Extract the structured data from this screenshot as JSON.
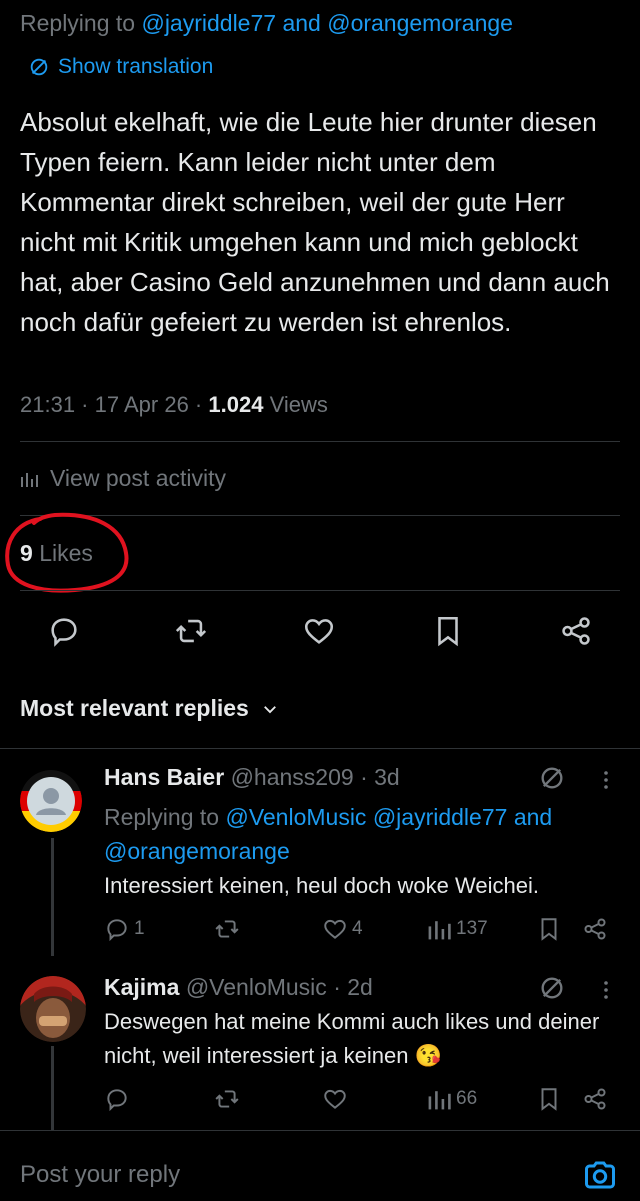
{
  "post": {
    "replying_prefix": "Replying to",
    "replying_handle_1": "@jayriddle77",
    "replying_and": "and",
    "replying_handle_2": "@orangemorange",
    "show_translation": "Show translation",
    "text": "Absolut ekelhaft, wie die Leute hier drunter diesen Typen feiern. Kann leider nicht unter dem Kommentar direkt schreiben, weil der gute Herr nicht mit Kritik umgehen kann und mich geblockt hat, aber Casino Geld anzunehmen und dann auch noch dafür gefeiert zu werden ist ehrenlos.",
    "time": "21:31",
    "date": "17 Apr 26",
    "views_count": "1.024",
    "views_label": "Views",
    "view_activity": "View post activity",
    "likes_count": "9",
    "likes_label": "Likes"
  },
  "action_icons": [
    "reply-icon",
    "repost-icon",
    "like-icon",
    "bookmark-icon",
    "share-icon"
  ],
  "sort": {
    "label": "Most relevant replies"
  },
  "replies": [
    {
      "name": "Hans Baier",
      "handle": "@hanss209",
      "time": "3d",
      "replying_prefix": "Replying to",
      "replying_handles": "@VenloMusic @jayriddle77",
      "replying_and": "and",
      "replying_handle_last": "@orangemorange",
      "text": "Interessiert keinen, heul doch woke Weichei.",
      "reply_count": "1",
      "repost_count": "",
      "like_count": "4",
      "views": "137"
    },
    {
      "name": "Kajima",
      "handle": "@VenloMusic",
      "time": "2d",
      "text": "Deswegen hat meine Kommi auch likes und deiner nicht, weil interessiert ja keinen 😘",
      "reply_count": "",
      "repost_count": "",
      "like_count": "",
      "views": "66"
    }
  ],
  "compose": {
    "placeholder": "Post your reply"
  },
  "colors": {
    "accent": "#1d9bf0",
    "muted": "#71767b",
    "annotation": "#e0121f"
  }
}
